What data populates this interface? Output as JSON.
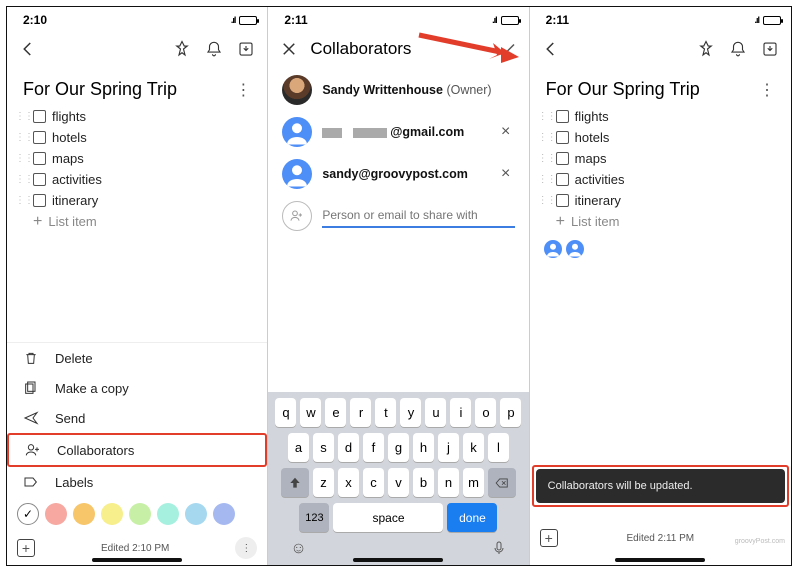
{
  "pane1": {
    "time": "2:10",
    "title": "For Our Spring Trip",
    "items": [
      "flights",
      "hotels",
      "maps",
      "activities",
      "itinerary"
    ],
    "new_item_placeholder": "List item",
    "menu": {
      "delete": "Delete",
      "copy": "Make a copy",
      "send": "Send",
      "collab": "Collaborators",
      "labels": "Labels"
    },
    "colors": [
      "#f6a8a1",
      "#f7c56a",
      "#f7ef8c",
      "#c7f0a6",
      "#a6f0e0",
      "#a6d8f0",
      "#a6b8f0"
    ],
    "footer": "Edited 2:10 PM"
  },
  "pane2": {
    "time": "2:11",
    "title": "Collaborators",
    "owner_name": "Sandy Writtenhouse",
    "owner_tag": "(Owner)",
    "c1_suffix": "@gmail.com",
    "c2": "sandy@groovypost.com",
    "placeholder": "Person or email to share with",
    "keys_r1": [
      "q",
      "w",
      "e",
      "r",
      "t",
      "y",
      "u",
      "i",
      "o",
      "p"
    ],
    "keys_r2": [
      "a",
      "s",
      "d",
      "f",
      "g",
      "h",
      "j",
      "k",
      "l"
    ],
    "keys_r3": [
      "z",
      "x",
      "c",
      "v",
      "b",
      "n",
      "m"
    ],
    "key_123": "123",
    "key_space": "space",
    "key_done": "done"
  },
  "pane3": {
    "time": "2:11",
    "title": "For Our Spring Trip",
    "items": [
      "flights",
      "hotels",
      "maps",
      "activities",
      "itinerary"
    ],
    "new_item_placeholder": "List item",
    "snackbar": "Collaborators will be updated.",
    "footer": "Edited 2:11 PM"
  }
}
